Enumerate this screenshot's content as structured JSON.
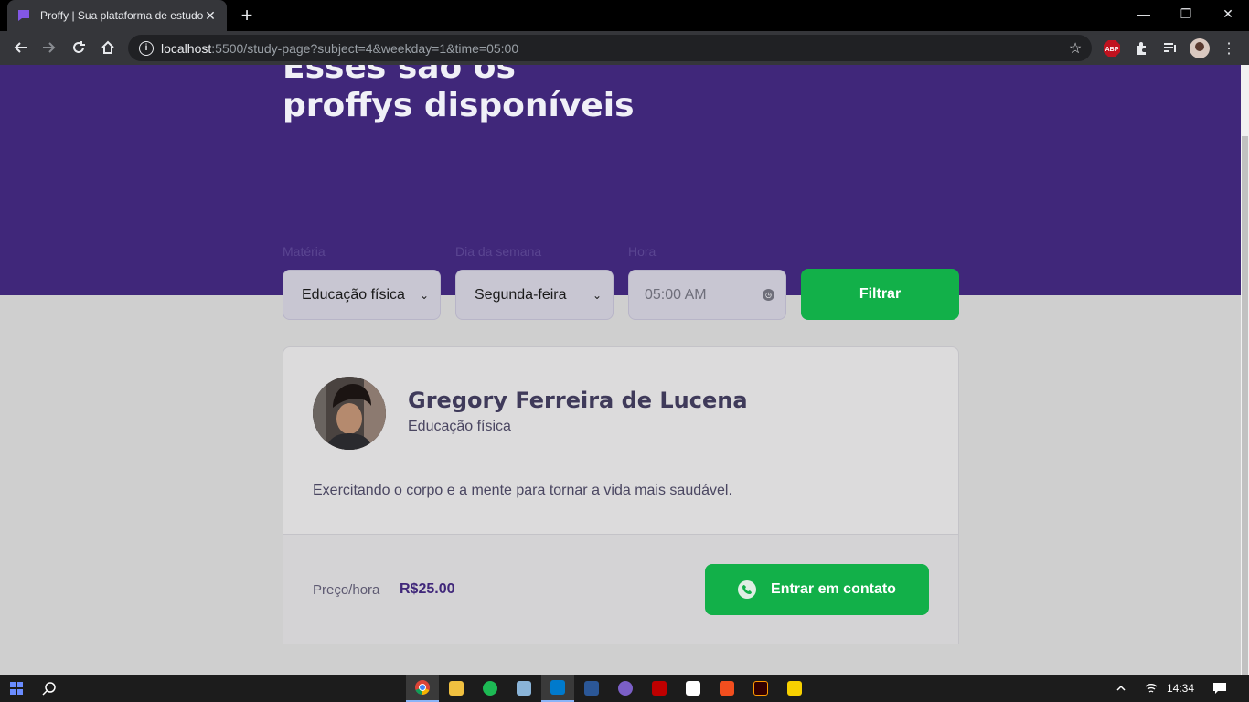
{
  "browser": {
    "tab_title": "Proffy | Sua plataforma de estudos",
    "url_host": "localhost",
    "url_rest": ":5500/study-page?subject=4&weekday=1&time=05:00"
  },
  "hero": {
    "title_line1": "Esses são os",
    "title_line2": "proffys disponíveis"
  },
  "filters": {
    "subject_label": "Matéria",
    "subject_value": "Educação física",
    "weekday_label": "Dia da semana",
    "weekday_value": "Segunda-feira",
    "time_label": "Hora",
    "time_value": "05:00 AM",
    "submit_label": "Filtrar"
  },
  "teacher": {
    "name": "Gregory Ferreira de Lucena",
    "subject": "Educação física",
    "bio": "Exercitando o corpo e a mente para tornar a vida mais saudável.",
    "price_label": "Preço/hora",
    "price": "R$25.00",
    "contact_label": "Entrar em contato"
  },
  "taskbar": {
    "time": "14:34"
  },
  "colors": {
    "primary": "#40277a",
    "secondary": "#12b049"
  }
}
